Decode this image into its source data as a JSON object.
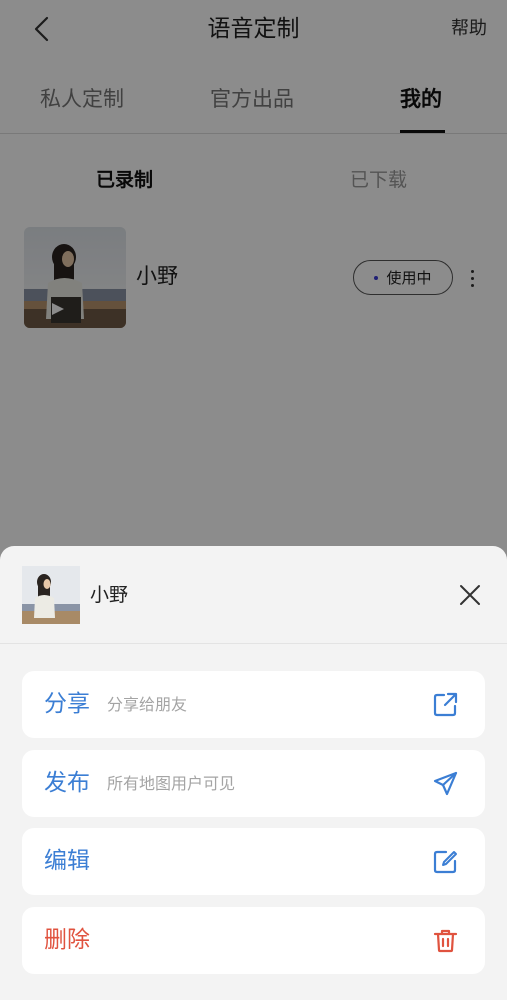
{
  "header": {
    "title": "语音定制",
    "help_label": "帮助"
  },
  "tabs": [
    {
      "label": "私人定制",
      "active": false
    },
    {
      "label": "官方出品",
      "active": false
    },
    {
      "label": "我的",
      "active": true
    }
  ],
  "subtabs": [
    {
      "label": "已录制",
      "active": true
    },
    {
      "label": "已下载",
      "active": false
    }
  ],
  "voice": {
    "name": "小野",
    "status_label": "使用中",
    "status_dot_color": "#3b3bd6"
  },
  "sheet": {
    "voice_name": "小野",
    "actions": [
      {
        "label": "分享",
        "desc": "分享给朋友",
        "icon": "share-external-icon",
        "color": "#3b7ed4"
      },
      {
        "label": "发布",
        "desc": "所有地图用户可见",
        "icon": "paper-plane-icon",
        "color": "#3b7ed4"
      },
      {
        "label": "编辑",
        "desc": "",
        "icon": "edit-square-icon",
        "color": "#3b7ed4"
      },
      {
        "label": "删除",
        "desc": "",
        "icon": "trash-icon",
        "color": "#e0533f"
      }
    ]
  }
}
